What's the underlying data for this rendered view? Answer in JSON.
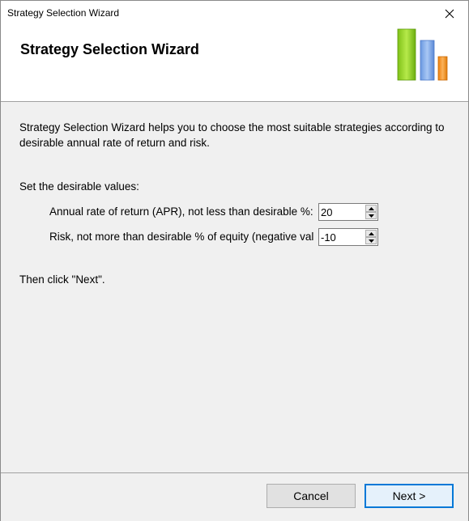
{
  "window": {
    "title": "Strategy Selection Wizard"
  },
  "header": {
    "title": "Strategy Selection Wizard",
    "logo_icon": "bar-chart-logo-icon",
    "logo_colors": [
      "#8fce1e",
      "#6e9fe6",
      "#f28c16"
    ]
  },
  "content": {
    "intro": "Strategy Selection Wizard helps you to choose the most suitable strategies according to desirable annual rate of return and risk.",
    "set_label": "Set the desirable values:",
    "fields": [
      {
        "label": "Annual rate of return (APR), not less than desirable %:",
        "value": "20"
      },
      {
        "label": "Risk, not more than desirable % of equity (negative val",
        "value": "-10"
      }
    ],
    "then_label": "Then click \"Next\"."
  },
  "footer": {
    "cancel_label": "Cancel",
    "next_label": "Next >"
  }
}
